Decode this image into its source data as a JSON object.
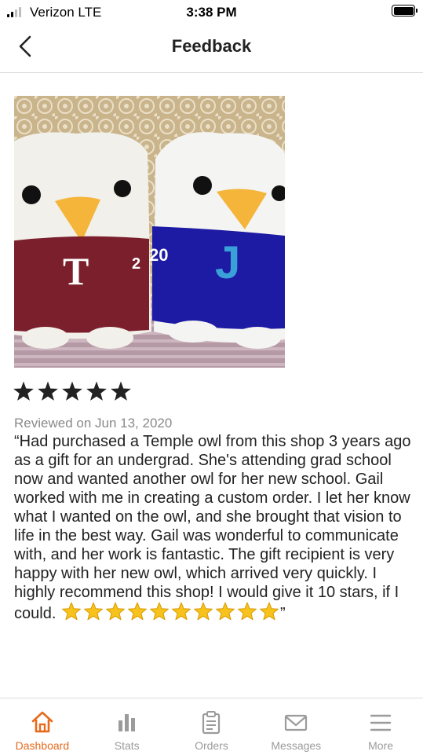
{
  "status_bar": {
    "carrier": "Verizon  LTE",
    "time": "3:38 PM"
  },
  "nav": {
    "title": "Feedback",
    "back_icon": "chevron-left-icon"
  },
  "review": {
    "rating": 5,
    "rating_max": 5,
    "date": "Reviewed on Jun 13, 2020",
    "text": "“Had purchased a Temple owl from this shop 3 years ago as a gift for an undergrad. She's attending grad school now and wanted another owl for her new school. Gail worked with me in creating a custom order. I let her know what I wanted on the owl, and she brought that vision to life in the best way. Gail was wonderful to communicate with, and her work is fantastic. The gift recipient is very happy with her new owl, which arrived very quickly. I highly recommend this shop! I would give it 10 stars, if I could. ",
    "emoji_star_count": 10,
    "text_close": "”",
    "photo": {
      "jersey_left_letter": "T",
      "jersey_left_number": "2",
      "jersey_right_number": "20",
      "jersey_right_letter": "J"
    }
  },
  "tabs": [
    {
      "label": "Dashboard",
      "icon": "home-icon",
      "active": true
    },
    {
      "label": "Stats",
      "icon": "bar-chart-icon",
      "active": false
    },
    {
      "label": "Orders",
      "icon": "clipboard-icon",
      "active": false
    },
    {
      "label": "Messages",
      "icon": "envelope-icon",
      "active": false
    },
    {
      "label": "More",
      "icon": "hamburger-menu-icon",
      "active": false
    }
  ],
  "colors": {
    "accent": "#e66a1c",
    "inactive_tab": "#9b9b9b",
    "date_gray": "#8a8a8a",
    "star_dark": "#222222",
    "emoji_star": "#f7c21b"
  }
}
